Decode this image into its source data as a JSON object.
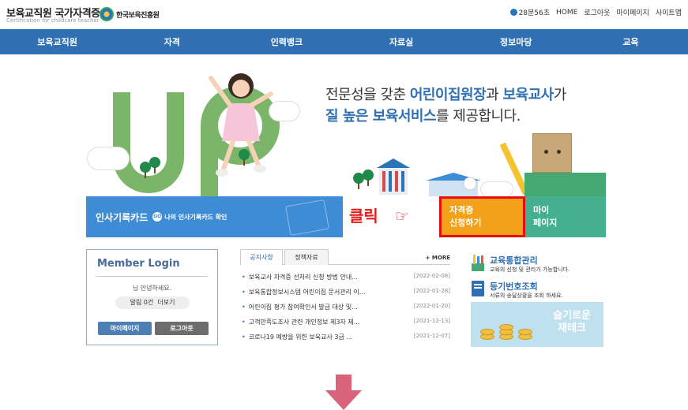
{
  "header": {
    "site_title": "보육교직원 국가자격증",
    "site_subtitle": "Certification for childcare teacher",
    "org_name": "한국보육진흥원",
    "timer": "28분56초",
    "util_links": [
      "HOME",
      "로그아웃",
      "마이페이지",
      "사이트맵"
    ]
  },
  "nav": [
    "보육교직원",
    "자격",
    "인력뱅크",
    "자료실",
    "정보마당",
    "교육"
  ],
  "hero": {
    "line1_pre": "전문성을 갖춘 ",
    "line1_hl1": "어린이집원장",
    "line1_mid": "과 ",
    "line1_hl2": "보육교사",
    "line1_post": "가",
    "line2_hl": "질 높은 보육서비스",
    "line2_post": "를 제공합니다."
  },
  "banners": {
    "record_title": "인사기록카드",
    "go_badge": "GO",
    "record_sub": "나의 인사기록카드 확인",
    "click_label": "클릭",
    "apply_line1": "자격증",
    "apply_line2": "신청하기",
    "mypage_line1": "마이",
    "mypage_line2": "페이지"
  },
  "login": {
    "title": "Member Login",
    "greeting": "님 안녕하세요.",
    "alarm_label": "알림 0건",
    "alarm_more": "더보기",
    "mypage_btn": "마이페이지",
    "logout_btn": "로그아웃"
  },
  "notices": {
    "tab_notice": "공지사항",
    "tab_policy": "정책자료",
    "more": "+ MORE",
    "items": [
      {
        "title": "보육교사 자격증 선처리 신청 방법 안내...",
        "date": "[2022-02-08]"
      },
      {
        "title": "보육통합정보시스템 어린이집 문서관리 이...",
        "date": "[2022-01-28]"
      },
      {
        "title": "어린이집 평가 참여확인서 발급 대상 및...",
        "date": "[2022-01-20]"
      },
      {
        "title": "고객만족도조사 관련 개인정보 제3자 제...",
        "date": "[2021-12-13]"
      },
      {
        "title": "코로나19 예방을 위한 보육교사 3급 ...",
        "date": "[2021-12-07]"
      }
    ]
  },
  "side": {
    "edu_title": "교육통합관리",
    "edu_desc": "교육의 신청 및 관리가 가능합니다.",
    "reg_title": "등기번호조회",
    "reg_desc": "서류의 송달상황을 조회 하세요.",
    "savings_line1": "슬기로운",
    "savings_line2": "재테크"
  },
  "colors": {
    "nav_blue": "#2f6fb2",
    "banner_blue": "#3f8cd6",
    "apply_orange": "#f3a01b",
    "highlight_red": "#e60e0e",
    "mypage_teal": "#44b08f",
    "arrow_pink": "#d9637b"
  },
  "icons": {
    "timer": "clock-icon",
    "hand": "pointing-hand-icon",
    "edu": "pencils-icon",
    "reg": "book-icon",
    "arrow": "arrow-down-icon"
  }
}
